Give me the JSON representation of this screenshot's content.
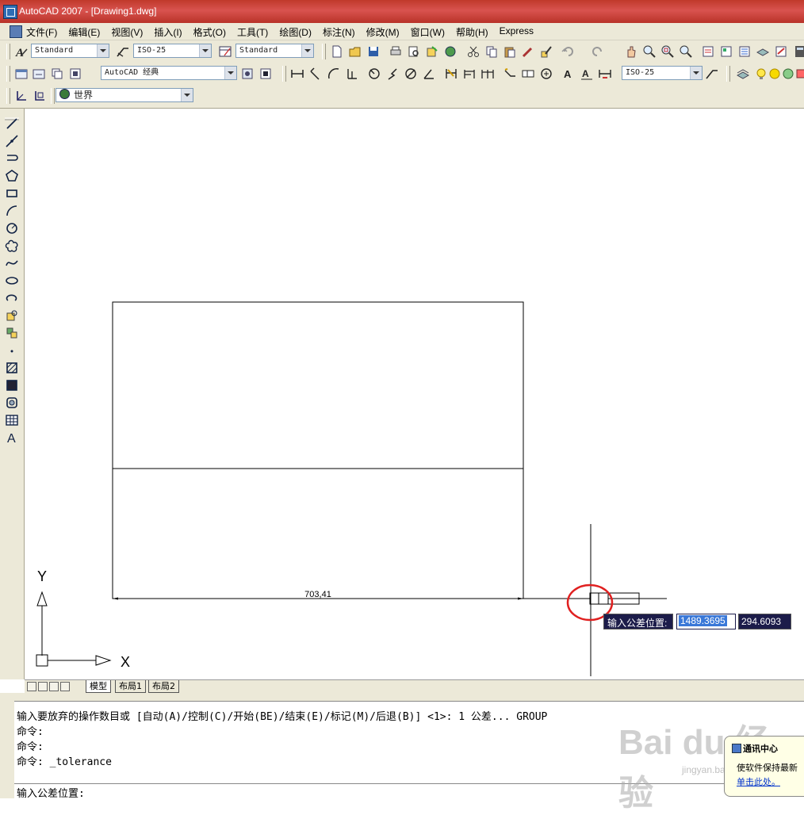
{
  "window": {
    "title": "AutoCAD 2007 - [Drawing1.dwg]"
  },
  "menu": [
    "文件(F)",
    "编辑(E)",
    "视图(V)",
    "插入(I)",
    "格式(O)",
    "工具(T)",
    "绘图(D)",
    "标注(N)",
    "修改(M)",
    "窗口(W)",
    "帮助(H)",
    "Express"
  ],
  "toolbar1": {
    "text_style": "Standard",
    "dim_style": "ISO-25",
    "table_style": "Standard"
  },
  "toolbar2": {
    "workspace": "AutoCAD 经典",
    "dim_style2": "ISO-25"
  },
  "toolbar3": {
    "ucs": "世界"
  },
  "drawing": {
    "dimension_text": "703,41",
    "axis_x": "X",
    "axis_y": "Y"
  },
  "dynamic_input": {
    "prompt": "输入公差位置:",
    "x_value": "1489.3695",
    "y_value": "294.6093"
  },
  "tabs": {
    "model": "模型",
    "layout1": "布局1",
    "layout2": "布局2"
  },
  "command": {
    "history": [
      "输入要放弃的操作数目或 [自动(A)/控制(C)/开始(BE)/结束(E)/标记(M)/后退(B)] <1>: 1 公差... GROUP",
      "命令:",
      "命令:",
      "命令: _tolerance"
    ],
    "prompt": "输入公差位置:"
  },
  "notification": {
    "title": "通讯中心",
    "body": "使软件保持最新",
    "link": "单击此处。"
  },
  "watermark": {
    "brand": "Bai du 经验",
    "url": "jingyan.baidu.com"
  },
  "colors": {
    "title_bar": "#c0392b",
    "dyn_input_bg": "#1c1c4a",
    "dyn_selected": "#3a78d8",
    "annotation_circle": "#e02020"
  }
}
